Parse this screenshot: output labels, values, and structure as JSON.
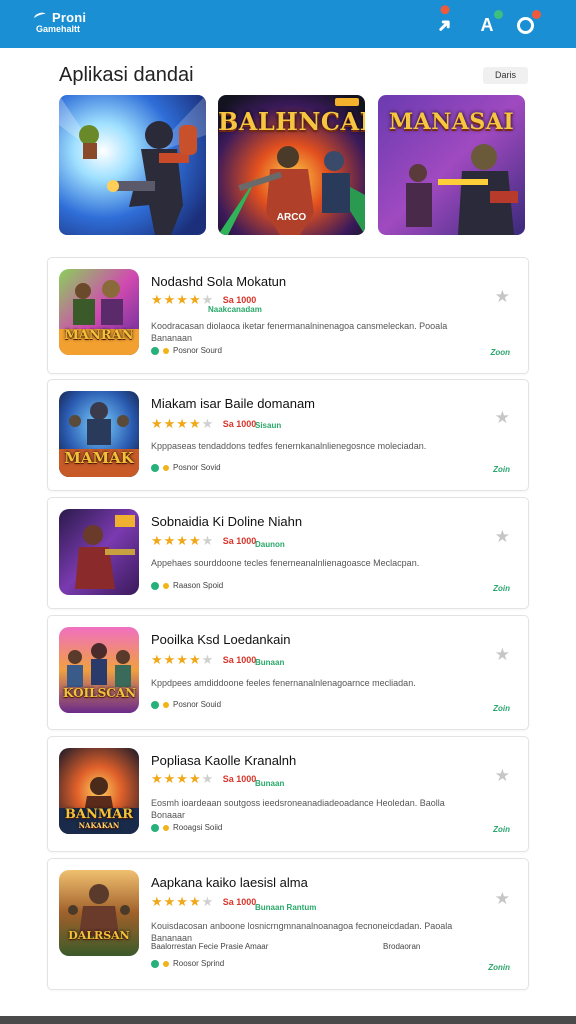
{
  "header": {
    "brand": "Proni",
    "brand_sub": "Gamehaltt",
    "icons": [
      "share-arrow-icon",
      "user-icon",
      "notification-icon"
    ],
    "accent_color": "#1a8fd4"
  },
  "section": {
    "title": "Aplikasi dandai",
    "filter_label": "Daris"
  },
  "banners": [
    {
      "title": "",
      "caption": ""
    },
    {
      "title": "BALHNCAK",
      "caption": "ARCO"
    },
    {
      "title": "MANASAI",
      "caption": ""
    }
  ],
  "apps": [
    {
      "thumb_label": "MANRAN",
      "thumb_sub": "",
      "title": "Nodashd Sola Mokatun",
      "rating": 4,
      "price": "Sa 1000",
      "price_sub": "Naakcanadam",
      "desc": "Koodracasan diolaoca iketar fenermanalninenagoa cansmeleckan. Pooala Bananaan",
      "meta": "Posnor Sourd",
      "action": "Zoon"
    },
    {
      "thumb_label": "MAMAK",
      "thumb_sub": "",
      "title": "Miakam isar Baile domanam",
      "rating": 4,
      "price": "Sa 1000",
      "price_sub": "Sisaun",
      "desc": "Kpppaseas tendaddons tedfes fenernkanalnlienegosnce moleciadan.",
      "meta": "Posnor Sovid",
      "action": "Zoin"
    },
    {
      "thumb_label": "",
      "thumb_sub": "",
      "title": "Sobnaidia Ki Doline Niahn",
      "rating": 4,
      "price": "Sa 1000",
      "price_sub": "Daunon",
      "desc": "Appehaes sourddoone tecles fenerneanalnlienagoasce Meclacpan.",
      "meta": "Raason Spoid",
      "action": "Zoin"
    },
    {
      "thumb_label": "KOILSCAN",
      "thumb_sub": "",
      "title": "Pooilka Ksd Loedankain",
      "rating": 4,
      "price": "Sa 1000",
      "price_sub": "Bunaan",
      "desc": "Kppdpees amdiddoone feeles fenernanalnlenagoarnce mecliadan.",
      "meta": "Posnor Souid",
      "action": "Zoin"
    },
    {
      "thumb_label": "BANMAR",
      "thumb_sub": "NAKAKAN",
      "title": "Popliasa Kaolle Kranalnh",
      "rating": 4,
      "price": "Sa 1000",
      "price_sub": "Bunaan",
      "desc": "Eosmh ioardeaan soutgoss ieedsroneanadiadeoadance Heoledan. Baolla Bonaaar",
      "meta": "Rooagsi Soiid",
      "action": "Zoin"
    },
    {
      "thumb_label": "DALRSAN",
      "thumb_sub": "",
      "title": "Aapkana kaiko laesisl alma",
      "rating": 4,
      "price": "Sa 1000",
      "price_sub": "Bunaan Rantum",
      "desc": "Kouisdacosan anboone losnicrngmnanalnoanagoa fecnoneicdadan. Paoala Bananaan",
      "extra": "Baalorrestan Fecie Prasie Amaar",
      "extra_right": "Brodaoran",
      "meta": "Roosor Sprind",
      "action": "Zonin"
    }
  ],
  "ui": {
    "star_full": "★★★★",
    "star_empty": "★",
    "fav_icon": "★"
  }
}
